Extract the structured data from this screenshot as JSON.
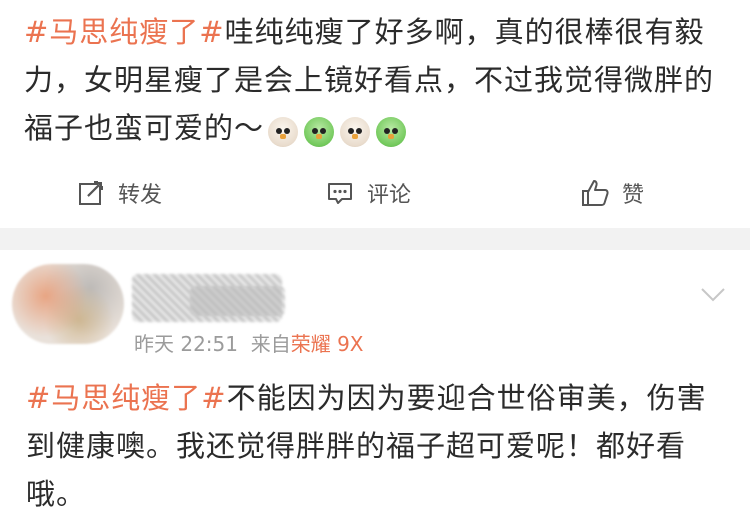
{
  "post1": {
    "hashtag": "#马思纯瘦了#",
    "text": "哇纯纯瘦了好多啊，真的很棒很有毅力，女明星瘦了是会上镜好看点，不过我觉得微胖的福子也蛮可爱的～",
    "emojis": [
      "chick-white-icon",
      "chick-green-icon",
      "chick-white-icon",
      "chick-green-icon"
    ]
  },
  "actions": {
    "repost_label": "转发",
    "comment_label": "评论",
    "like_label": "赞"
  },
  "post2": {
    "time": "昨天 22:51",
    "source_prefix": "来自",
    "device": "荣耀 9X",
    "hashtag": "#马思纯瘦了#",
    "text": "不能因为因为要迎合世俗审美，伤害到健康噢。我还觉得胖胖的福子超可爱呢！都好看哦。"
  },
  "colors": {
    "accent": "#eb7350",
    "text": "#2b2b2b",
    "meta": "#9b9b9b",
    "divider": "#f2f2f2"
  }
}
